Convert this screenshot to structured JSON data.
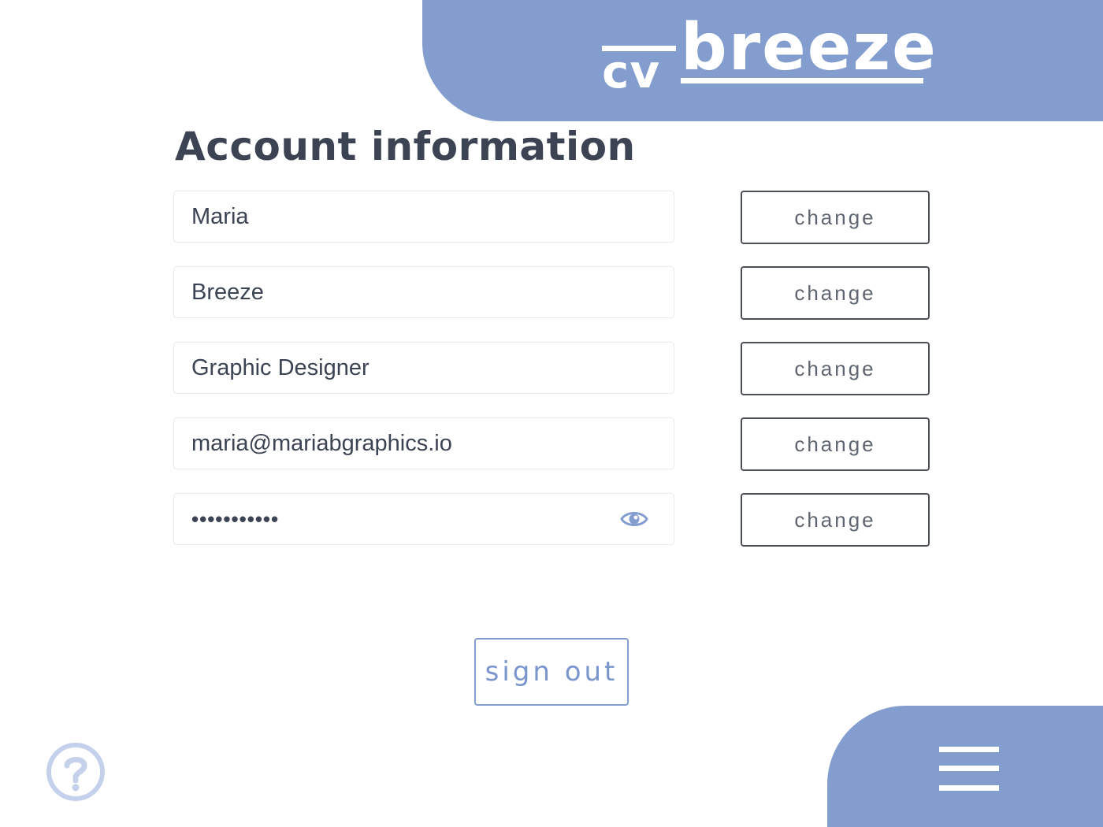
{
  "brand": {
    "logo_prefix": "cv",
    "logo_name": "breeze",
    "accent_color": "#839dce",
    "text_color": "#3c4352"
  },
  "page": {
    "title": "Account information"
  },
  "fields": [
    {
      "value": "Maria",
      "button_label": "change"
    },
    {
      "value": "Breeze",
      "button_label": "change"
    },
    {
      "value": "Graphic Designer",
      "button_label": "change"
    },
    {
      "value": "maria@mariabgraphics.io",
      "button_label": "change"
    },
    {
      "value": "•••••••••••",
      "button_label": "change",
      "type": "password",
      "icon": "eye-icon"
    }
  ],
  "actions": {
    "sign_out_label": "sign out"
  },
  "icons": {
    "help": "question-circle-icon",
    "menu": "hamburger-menu-icon"
  }
}
